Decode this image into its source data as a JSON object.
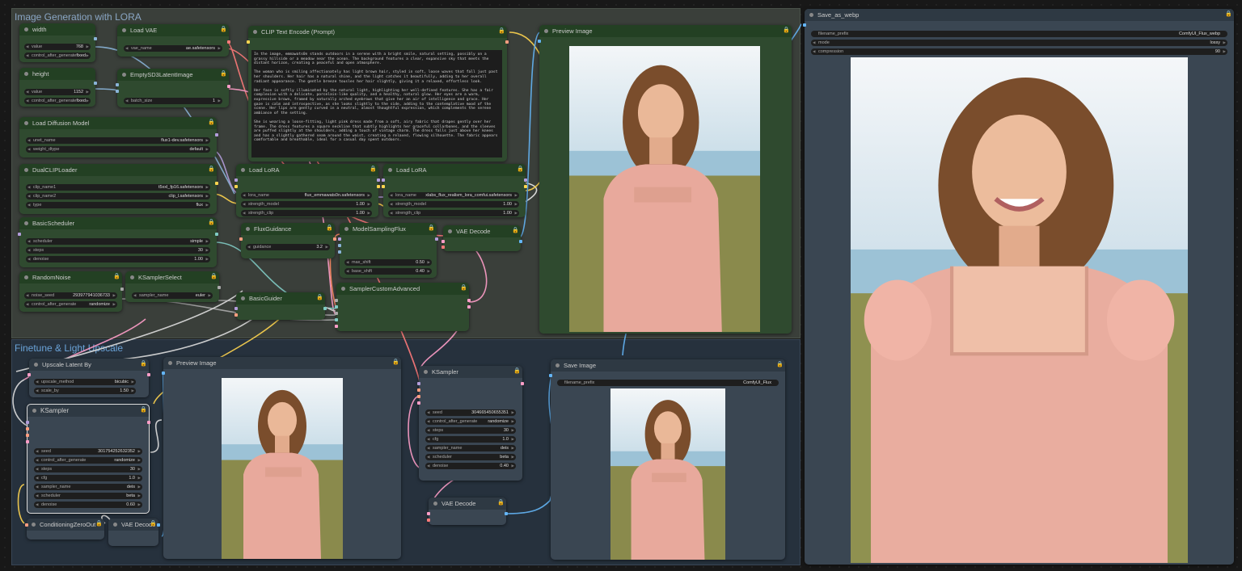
{
  "groups": {
    "lora": "Image Generation with LORA",
    "finetune": "Finetune & Light Upscale"
  },
  "nodes": {
    "width": {
      "title": "width",
      "value_label": "value",
      "value": "768",
      "caf_label": "control_after_generate",
      "caf": "fixed"
    },
    "height": {
      "title": "height",
      "value_label": "value",
      "value": "1152",
      "caf_label": "control_after_generate",
      "caf": "fixed"
    },
    "load_vae": {
      "title": "Load VAE",
      "label": "vae_name",
      "value": "ae.safetensors"
    },
    "empty_latent": {
      "title": "EmptySD3LatentImage",
      "label": "batch_size",
      "value": "1"
    },
    "load_diffusion": {
      "title": "Load Diffusion Model",
      "unet_label": "unet_name",
      "unet": "flux1-dev.safetensors",
      "dtype_label": "weight_dtype",
      "dtype": "default"
    },
    "dual_clip": {
      "title": "DualCLIPLoader",
      "c1_label": "clip_name1",
      "c1": "t5xxl_fp16.safetensors",
      "c2_label": "clip_name2",
      "c2": "clip_l.safetensors",
      "type_label": "type",
      "type": "flux"
    },
    "basic_scheduler": {
      "title": "BasicScheduler",
      "s_label": "scheduler",
      "s": "simple",
      "steps_label": "steps",
      "steps": "30",
      "denoise_label": "denoise",
      "denoise": "1.00"
    },
    "random_noise": {
      "title": "RandomNoise",
      "seed_label": "noise_seed",
      "seed": "293977941036733",
      "caf_label": "control_after_generate",
      "caf": "randomize"
    },
    "ksampler_select": {
      "title": "KSamplerSelect",
      "label": "sampler_name",
      "value": "euler"
    },
    "clip_text": {
      "title": "CLIP Text Encode (Prompt)",
      "text": "In the image, emmawats0n stands outdoors in a serene with a bright smile, natural setting, possibly on a grassy hillside or a meadow near the ocean. The background features a clear, expansive sky that meets the distant horizon, creating a peaceful and open atmosphere.\n\nThe woman who is smiling affectionately has light brown hair, styled in soft, loose waves that fall just past her shoulders. Her hair has a natural shine, and the light catches it beautifully, adding to her overall radiant appearance. The gentle breeze tousles her hair slightly, giving it a relaxed, effortless look.\n\nHer face is softly illuminated by the natural light, highlighting her well-defined features. She has a fair complexion with a delicate, porcelain-like quality, and a healthy, natural glow. Her eyes are a warm, expressive brown, framed by naturally arched eyebrows that give her an air of intelligence and grace. Her gaze is calm and introspective, as she looks slightly to the side, adding to the contemplative mood of the scene. Her lips are gently curved in a neutral, almost thoughtful expression, which complements the serene ambiance of the setting.\n\nShe is wearing a loose-fitting, light pink dress made from a soft, airy fabric that drapes gently over her frame. The dress features a square neckline that subtly highlights her graceful collarbones, and the sleeves are puffed slightly at the shoulders, adding a touch of vintage charm. The dress falls just above her knees and has a slightly gathered seam around the waist, creating a relaxed, flowing silhouette. The fabric appears comfortable and breathable, ideal for a casual day spent outdoors."
    },
    "load_lora1": {
      "title": "Load LoRA",
      "name_label": "lora_name",
      "name": "flux_emmawats0n.safetensors",
      "sm_label": "strength_model",
      "sm": "1.00",
      "sc_label": "strength_clip",
      "sc": "1.00"
    },
    "load_lora2": {
      "title": "Load LoRA",
      "name_label": "lora_name",
      "name": "xlabs_flux_realism_lora_comfui.safetensors",
      "sm_label": "strength_model",
      "sm": "1.00",
      "sc_label": "strength_clip",
      "sc": "1.00"
    },
    "flux_guidance": {
      "title": "FluxGuidance",
      "label": "guidance",
      "value": "3.2"
    },
    "model_sampling": {
      "title": "ModelSamplingFlux",
      "max_label": "max_shift",
      "max": "0.50",
      "base_label": "base_shift",
      "base": "0.40"
    },
    "vae_decode1": {
      "title": "VAE Decode"
    },
    "basic_guider": {
      "title": "BasicGuider"
    },
    "sampler_custom": {
      "title": "SamplerCustomAdvanced"
    },
    "preview1": {
      "title": "Preview Image"
    },
    "upscale": {
      "title": "Upscale Latent By",
      "m_label": "upscale_method",
      "m": "bicubic",
      "s_label": "scale_by",
      "s": "1.50"
    },
    "ksampler_left": {
      "title": "KSampler",
      "seed_label": "seed",
      "seed": "301754252632352",
      "caf_label": "control_after_generate",
      "caf": "randomize",
      "steps_label": "steps",
      "steps": "30",
      "cfg_label": "cfg",
      "cfg": "1.0",
      "sn_label": "sampler_name",
      "sn": "deis",
      "sch_label": "scheduler",
      "sch": "beta",
      "den_label": "denoise",
      "den": "0.60"
    },
    "cond_zero": {
      "title": "ConditioningZeroOut"
    },
    "vae_decode2": {
      "title": "VAE Decode"
    },
    "preview2": {
      "title": "Preview Image"
    },
    "ksampler_mid": {
      "title": "KSampler",
      "seed_label": "seed",
      "seed": "304665450655351",
      "caf_label": "control_after_generate",
      "caf": "randomize",
      "steps_label": "steps",
      "steps": "30",
      "cfg_label": "cfg",
      "cfg": "1.0",
      "sn_label": "sampler_name",
      "sn": "deis",
      "sch_label": "scheduler",
      "sch": "beta",
      "den_label": "denoise",
      "den": "0.40"
    },
    "vae_decode3": {
      "title": "VAE Decode"
    },
    "save_image": {
      "title": "Save Image",
      "label": "filename_prefix",
      "value": "ComfyUI_Flux"
    },
    "save_webp": {
      "title": "Save_as_webp",
      "fp_label": "filename_prefix",
      "fp": "ComfyUI_Flux_webp",
      "mode_label": "mode",
      "mode": "lossy",
      "comp_label": "compression",
      "comp": "90"
    }
  },
  "colors": {
    "accent_lock": "#d5a52b",
    "green_node": "#2f4a2f",
    "slate_node": "#3a4652"
  }
}
